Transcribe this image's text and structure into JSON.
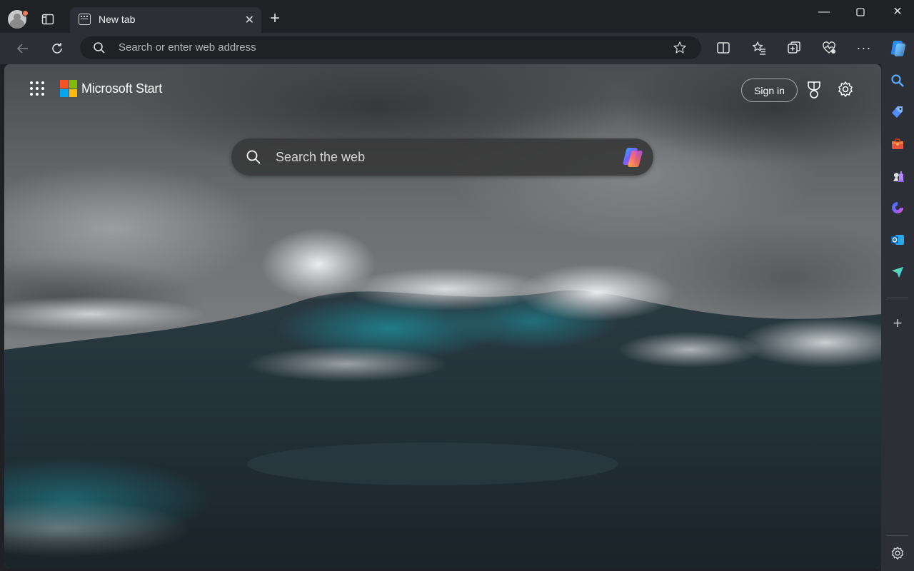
{
  "browser": {
    "tab": {
      "title": "New tab"
    },
    "address_bar": {
      "placeholder": "Search or enter web address"
    }
  },
  "page": {
    "brand": "Microsoft Start",
    "sign_in_label": "Sign in",
    "search_placeholder": "Search the web"
  },
  "sidebar": {
    "items": [
      "search-icon",
      "shopping-tag-icon",
      "tools-briefcase-icon",
      "games-icon",
      "copilot-icon",
      "outlook-icon",
      "send-icon",
      "add-icon",
      "settings-icon"
    ]
  },
  "colors": {
    "frame": "#1f2125",
    "toolbar": "#2c3036",
    "ms_red": "#f35325",
    "ms_green": "#81bc06",
    "ms_blue": "#05a6f0",
    "ms_yellow": "#ffba08"
  }
}
